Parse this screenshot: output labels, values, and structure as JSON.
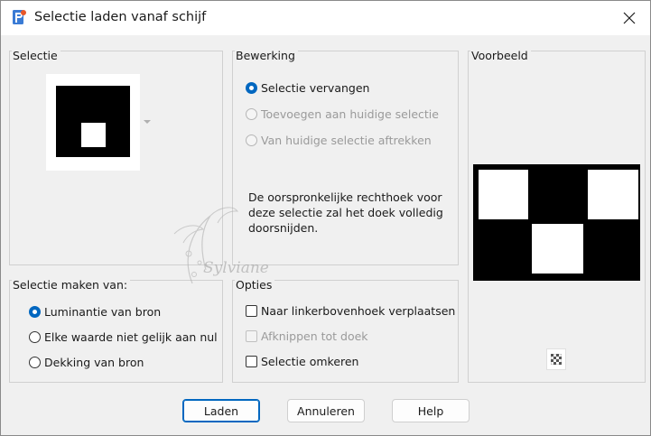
{
  "window": {
    "title": "Selectie laden vanaf schijf"
  },
  "selection_group": {
    "title": "Selectie"
  },
  "operation_group": {
    "title": "Bewerking",
    "options": [
      {
        "label": "Selectie vervangen",
        "checked": true,
        "disabled": false
      },
      {
        "label": "Toevoegen aan huidige selectie",
        "checked": false,
        "disabled": true
      },
      {
        "label": "Van huidige selectie aftrekken",
        "checked": false,
        "disabled": true
      }
    ],
    "description_lines": [
      "De oorspronkelijke rechthoek voor",
      "deze selectie zal het doek volledig",
      "doorsnijden."
    ]
  },
  "preview_group": {
    "title": "Voorbeeld"
  },
  "source_group": {
    "title": "Selectie maken van:",
    "options": [
      {
        "label": "Luminantie van bron",
        "checked": true
      },
      {
        "label": "Elke waarde niet gelijk aan nul",
        "checked": false
      },
      {
        "label": "Dekking van bron",
        "checked": false
      }
    ]
  },
  "options_group": {
    "title": "Opties",
    "options": [
      {
        "label": "Naar linkerbovenhoek verplaatsen",
        "checked": false,
        "disabled": false
      },
      {
        "label": "Afknippen tot doek",
        "checked": false,
        "disabled": true
      },
      {
        "label": "Selectie omkeren",
        "checked": false,
        "disabled": false
      }
    ]
  },
  "buttons": {
    "load": "Laden",
    "cancel": "Annuleren",
    "help": "Help"
  },
  "watermark": {
    "text": "Sylviane"
  },
  "colors": {
    "accent": "#0067c0",
    "background": "#f0f0f0",
    "titlebar": "#ffffff"
  }
}
